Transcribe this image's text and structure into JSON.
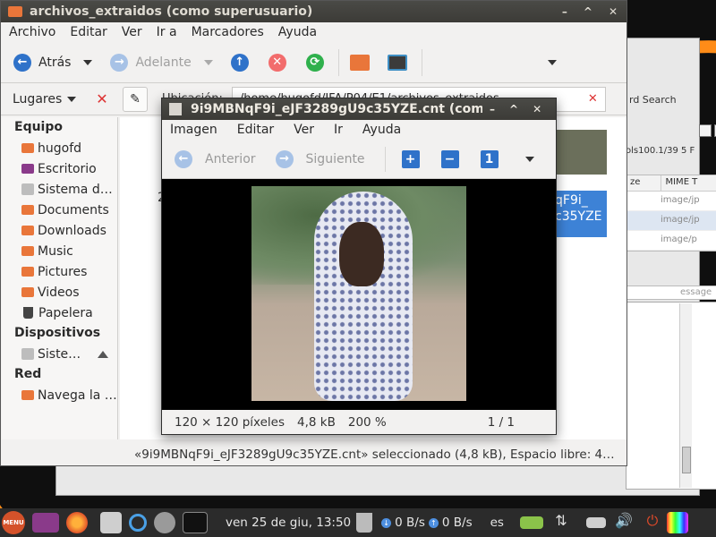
{
  "background_window": {
    "search_label": "rd Search",
    "info": "ols100.1/39  5  F",
    "table": {
      "columns": [
        "ze",
        "MIME T"
      ],
      "rows": [
        "image/jp",
        "image/jp",
        "image/p"
      ]
    },
    "message_placeholder": "essage"
  },
  "file_manager": {
    "title": "archivos_extraidos (como superusuario)",
    "menu": [
      "Archivo",
      "Editar",
      "Ver",
      "Ir a",
      "Marcadores",
      "Ayuda"
    ],
    "toolbar": {
      "back": "Atrás",
      "forward": "Adelante"
    },
    "places_label": "Lugares",
    "location_label": "Ubicación:",
    "path": "/home/hugofd/IFA/P04/E1/archivos_extraidos",
    "sidebar": {
      "equipo": {
        "heading": "Equipo",
        "items": [
          "hugofd",
          "Escritorio",
          "Sistema d…",
          "Documents",
          "Downloads",
          "Music",
          "Pictures",
          "Videos",
          "Papelera"
        ]
      },
      "dispositivos": {
        "heading": "Dispositivos",
        "items": [
          "Siste…"
        ]
      },
      "red": {
        "heading": "Red",
        "items": [
          "Navega la …"
        ]
      }
    },
    "selected_file_label": "qF9i_\nc35YZE",
    "partial_left_label": "2",
    "status": "«9i9MBNqF9i_eJF3289gU9c35YZE.cnt» seleccionado (4,8 kB), Espacio libre: 4…"
  },
  "viewer": {
    "title": "9i9MBNqF9i_eJF3289gU9c35YZE.cnt (como",
    "menu": [
      "Imagen",
      "Editar",
      "Ver",
      "Ir",
      "Ayuda"
    ],
    "toolbar": {
      "previous": "Anterior",
      "next": "Siguiente"
    },
    "status": {
      "dimensions": "120 × 120 píxeles",
      "size": "4,8 kB",
      "zoom": "200 %",
      "page": "1 / 1"
    }
  },
  "taskbar": {
    "menu_label": "MENU",
    "clock": "ven 25 de giu, 13:50",
    "down_speed": "0 B/s",
    "up_speed": "0 B/s",
    "language": "es"
  }
}
